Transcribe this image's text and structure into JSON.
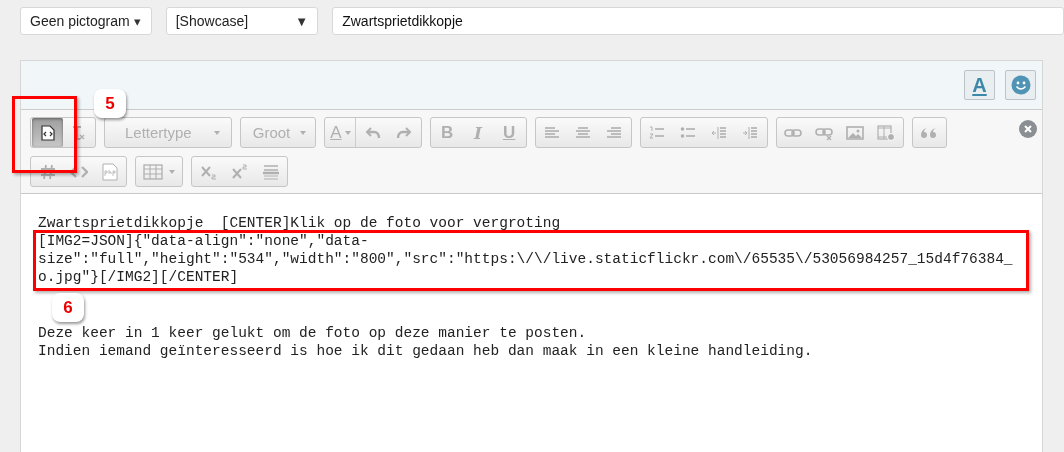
{
  "top_bar": {
    "icon_select": {
      "value": "Geen pictogram",
      "arrow": "▾"
    },
    "prefix_select": {
      "value": "[Showcase]",
      "arrow": "▼"
    },
    "title_field": {
      "value": "Zwartsprietdikkopje"
    }
  },
  "editor": {
    "header_buttons": [
      {
        "kind": "text-style",
        "label": "A"
      },
      {
        "kind": "smilies"
      }
    ],
    "toolbar_rows": [
      [
        {
          "buttons": [
            {
              "kind": "source",
              "selected": true,
              "disabled": false
            },
            {
              "kind": "clear-format",
              "selected": false,
              "disabled": true
            }
          ]
        },
        {
          "buttons": [
            {
              "kind": "dropdown",
              "label": "Lettertype",
              "selected": false,
              "disabled": true
            }
          ]
        },
        {
          "buttons": [
            {
              "kind": "dropdown",
              "label": "Groot",
              "selected": false,
              "disabled": true
            }
          ]
        },
        {
          "buttons": [
            {
              "kind": "font-color",
              "label": "A",
              "selected": false,
              "disabled": true
            },
            {
              "kind": "undo",
              "selected": false,
              "disabled": true
            },
            {
              "kind": "redo",
              "selected": false,
              "disabled": true
            }
          ]
        },
        {
          "buttons": [
            {
              "kind": "bold",
              "label": "B",
              "selected": false,
              "disabled": true
            },
            {
              "kind": "italic",
              "label": "I",
              "selected": false,
              "disabled": true
            },
            {
              "kind": "underline",
              "label": "U",
              "selected": false,
              "disabled": true
            }
          ]
        },
        {
          "buttons": [
            {
              "kind": "align-left",
              "selected": false,
              "disabled": true
            },
            {
              "kind": "align-center",
              "selected": false,
              "disabled": true
            },
            {
              "kind": "align-right",
              "selected": false,
              "disabled": true
            }
          ]
        },
        {
          "buttons": [
            {
              "kind": "ordered-list",
              "selected": false,
              "disabled": true
            },
            {
              "kind": "bullet-list",
              "selected": false,
              "disabled": true
            },
            {
              "kind": "outdent",
              "selected": false,
              "disabled": true
            },
            {
              "kind": "indent",
              "selected": false,
              "disabled": true
            }
          ]
        },
        {
          "buttons": [
            {
              "kind": "link",
              "selected": false,
              "disabled": true
            },
            {
              "kind": "unlink",
              "selected": false,
              "disabled": true
            },
            {
              "kind": "image",
              "selected": false,
              "disabled": true
            },
            {
              "kind": "media",
              "selected": false,
              "disabled": true
            }
          ]
        },
        {
          "buttons": [
            {
              "kind": "quote",
              "selected": false,
              "disabled": true
            }
          ]
        }
      ],
      [
        {
          "buttons": [
            {
              "kind": "hashtag",
              "selected": false,
              "disabled": true
            },
            {
              "kind": "code",
              "selected": false,
              "disabled": true
            },
            {
              "kind": "php",
              "selected": false,
              "disabled": true
            }
          ]
        },
        {
          "buttons": [
            {
              "kind": "table",
              "selected": false,
              "disabled": true
            }
          ]
        },
        {
          "buttons": [
            {
              "kind": "subscript",
              "selected": false,
              "disabled": true
            },
            {
              "kind": "superscript",
              "selected": false,
              "disabled": true
            },
            {
              "kind": "horizontal-rule",
              "selected": false,
              "disabled": true
            }
          ]
        }
      ]
    ],
    "paragraphs": [
      {
        "lines": [
          "Zwartsprietdikkopje  [CENTER]Klik op de foto voor vergroting",
          "[IMG2=JSON]{\"data-align\":\"none\",\"data-",
          "size\":\"full\",\"height\":\"534\",\"width\":\"800\",\"src\":\"https:\\/\\/live.staticflickr.com\\/65535\\/53056984257_15d4f76384_",
          "o.jpg\"}[/IMG2][/CENTER]"
        ]
      },
      {
        "lines": [
          "Deze keer in 1 keer gelukt om de foto op deze manier te posten.",
          "Indien iemand geïnteresseerd is hoe ik dit gedaan heb dan maak in een kleine handleiding."
        ]
      }
    ]
  },
  "annotations": [
    {
      "kind": "toolbar",
      "number": "5"
    },
    {
      "kind": "text",
      "number": "6"
    }
  ]
}
